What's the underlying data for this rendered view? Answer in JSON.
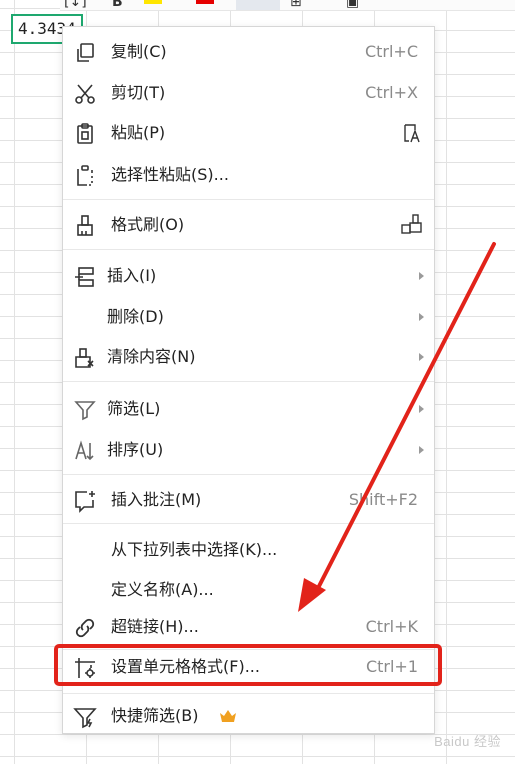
{
  "cell": {
    "value": "4.3434"
  },
  "menu": {
    "items": [
      {
        "label": "复制(C)",
        "shortcut": "Ctrl+C"
      },
      {
        "label": "剪切(T)",
        "shortcut": "Ctrl+X"
      },
      {
        "label": "粘贴(P)"
      },
      {
        "label": "选择性粘贴(S)..."
      },
      {
        "label": "格式刷(O)"
      },
      {
        "label": "插入(I)"
      },
      {
        "label": "删除(D)"
      },
      {
        "label": "清除内容(N)"
      },
      {
        "label": "筛选(L)"
      },
      {
        "label": "排序(U)"
      },
      {
        "label": "插入批注(M)",
        "shortcut": "Shift+F2"
      },
      {
        "label": "从下拉列表中选择(K)..."
      },
      {
        "label": "定义名称(A)..."
      },
      {
        "label": "超链接(H)...",
        "shortcut": "Ctrl+K"
      },
      {
        "label": "设置单元格格式(F)...",
        "shortcut": "Ctrl+1"
      },
      {
        "label": "快捷筛选(B)"
      }
    ]
  },
  "watermark": "Baidu 经验",
  "colors": {
    "selection": "#1ea86f",
    "annotation": "#e2231a",
    "crown": "#f0a020"
  },
  "icons": {
    "copy": "copy-icon",
    "cut": "scissors-icon",
    "paste": "clipboard-icon",
    "paste_special": "clipboard-dots-icon",
    "format_painter": "brush-icon",
    "insert": "insert-rows-icon",
    "clear": "eraser-icon",
    "filter": "funnel-icon",
    "sort": "sort-icon",
    "comment": "comment-add-icon",
    "link": "link-icon",
    "format_cells": "cell-format-gear-icon",
    "quick_filter": "funnel-lightning-icon",
    "crown": "crown-icon"
  }
}
